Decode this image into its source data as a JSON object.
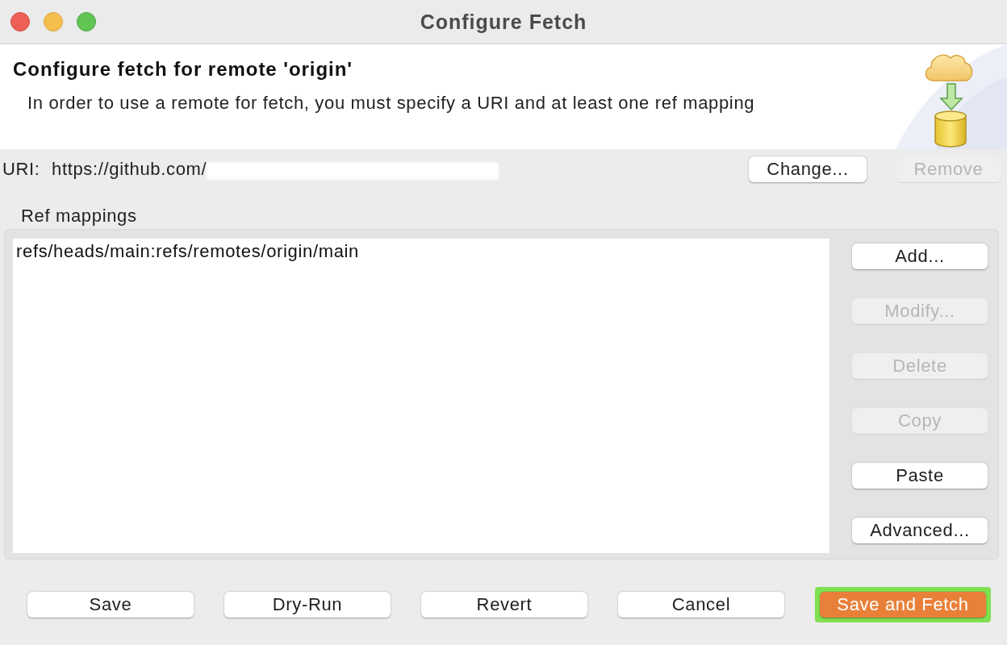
{
  "window": {
    "title": "Configure Fetch"
  },
  "header": {
    "title": "Configure fetch for remote 'origin'",
    "description": "In order to use a remote for fetch, you must specify a URI and at least one ref mapping"
  },
  "uri": {
    "label": "URI:",
    "value": "https://github.com/",
    "redacted": true,
    "buttons": [
      {
        "label": "Change...",
        "disabled": false
      },
      {
        "label": "Remove",
        "disabled": true
      }
    ]
  },
  "ref_mappings": {
    "label": "Ref mappings",
    "items": [
      {
        "text": "refs/heads/main:refs/remotes/origin/main",
        "selected": false
      }
    ],
    "buttons": [
      {
        "label": "Add...",
        "disabled": false
      },
      {
        "label": "Modify...",
        "disabled": true
      },
      {
        "label": "Delete",
        "disabled": true
      },
      {
        "label": "Copy",
        "disabled": true
      },
      {
        "label": "Paste",
        "disabled": false
      },
      {
        "label": "Advanced...",
        "disabled": false
      }
    ]
  },
  "footer_buttons": [
    {
      "label": "Save",
      "default": false,
      "highlighted": false
    },
    {
      "label": "Dry-Run",
      "default": false,
      "highlighted": false
    },
    {
      "label": "Revert",
      "default": false,
      "highlighted": false
    },
    {
      "label": "Cancel",
      "default": false,
      "highlighted": false
    },
    {
      "label": "Save and Fetch",
      "default": true,
      "highlighted": true
    }
  ]
}
